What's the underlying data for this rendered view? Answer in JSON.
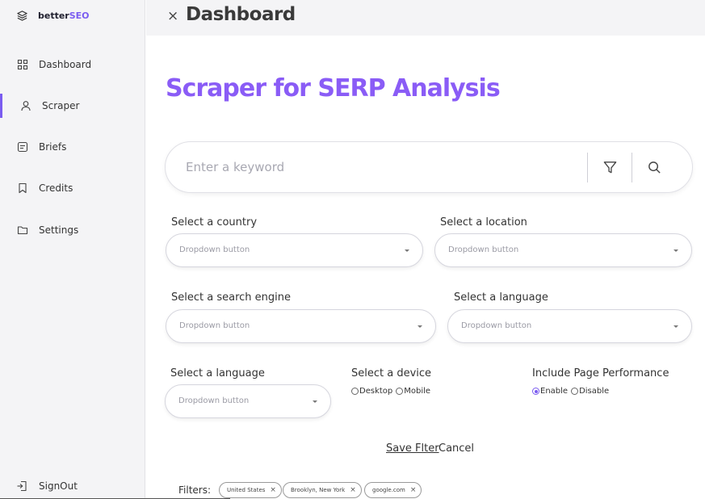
{
  "brand": {
    "name_prefix": "better",
    "name_accent": "SEO"
  },
  "sidebar": {
    "items": [
      {
        "label": "Dashboard",
        "icon": "grid-icon"
      },
      {
        "label": "Scraper",
        "icon": "user-icon",
        "active": true
      },
      {
        "label": "Briefs",
        "icon": "document-icon"
      },
      {
        "label": "Credits",
        "icon": "bookmark-icon"
      },
      {
        "label": "Settings",
        "icon": "folder-icon"
      }
    ],
    "signout": {
      "label": "SignOut",
      "icon": "sign-out-icon"
    }
  },
  "header": {
    "close_glyph": "×",
    "title": "Dashboard"
  },
  "main": {
    "title": "Scraper for SERP Analysis",
    "search": {
      "placeholder": "Enter a keyword",
      "value": ""
    },
    "fields": {
      "country": {
        "label": "Select a country",
        "value": "Dropdown button"
      },
      "location": {
        "label": "Select a location",
        "value": "Dropdown button"
      },
      "engine": {
        "label": "Select a search engine",
        "value": "Dropdown button"
      },
      "language1": {
        "label": "Select a language",
        "value": "Dropdown button"
      },
      "language2": {
        "label": "Select a language",
        "value": "Dropdown button"
      },
      "device": {
        "label": "Select a device",
        "options": [
          "Desktop",
          "Mobile"
        ],
        "selected": null
      },
      "performance": {
        "label": "Include Page Performance",
        "options": [
          "Enable",
          "Disable"
        ],
        "selected": "Enable"
      }
    },
    "actions": {
      "save": "Save Flter",
      "cancel": "Cancel"
    },
    "filters": {
      "label": "Filters:",
      "chips": [
        "United States",
        "Brooklyn, New York",
        "google.com"
      ],
      "remove_glyph": "×"
    }
  },
  "colors": {
    "accent": "#7a5cf0",
    "title": "#8a5cf6",
    "sidebar_bg": "#f4f4f6"
  }
}
